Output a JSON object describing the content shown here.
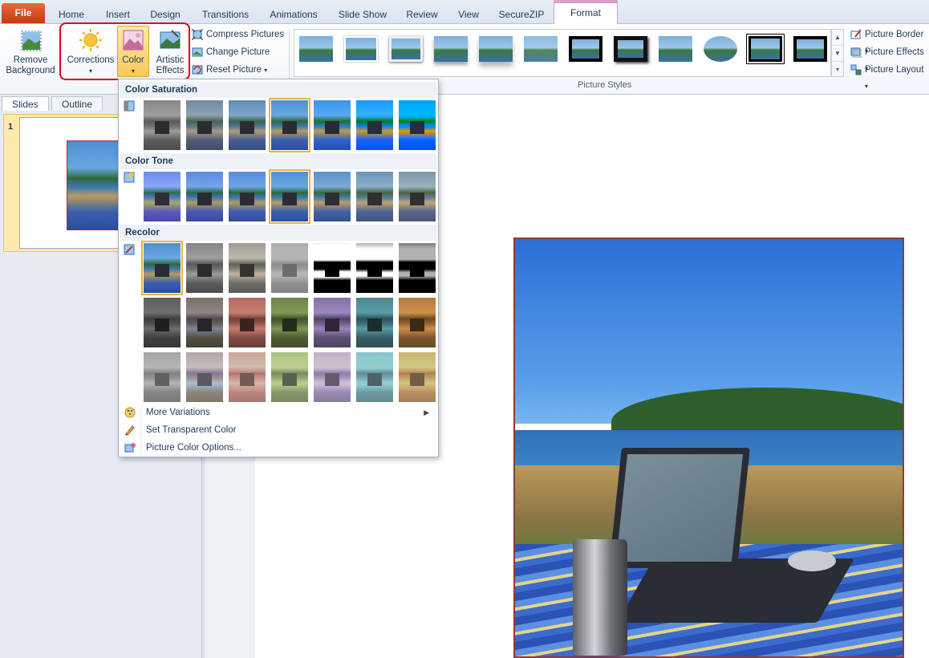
{
  "tabs": [
    "File",
    "Home",
    "Insert",
    "Design",
    "Transitions",
    "Animations",
    "Slide Show",
    "Review",
    "View",
    "SecureZIP",
    "Format"
  ],
  "active_tab": "Format",
  "ribbon": {
    "remove_background": "Remove Background",
    "corrections": "Corrections",
    "color": "Color",
    "artistic_effects": "Artistic Effects",
    "compress_pictures": "Compress Pictures",
    "change_picture": "Change Picture",
    "reset_picture": "Reset Picture",
    "picture_styles_label": "Picture Styles",
    "picture_border": "Picture Border",
    "picture_effects": "Picture Effects",
    "picture_layout": "Picture Layout"
  },
  "panel": {
    "slides_tab": "Slides",
    "outline_tab": "Outline",
    "slide_number": "1"
  },
  "color_menu": {
    "sections": [
      {
        "title": "Color Saturation",
        "selected_index": 3
      },
      {
        "title": "Color Tone",
        "selected_index": 3
      },
      {
        "title": "Recolor",
        "selected_index": 0
      }
    ],
    "items": [
      {
        "label": "More Variations",
        "has_submenu": true
      },
      {
        "label": "Set Transparent Color",
        "has_submenu": false
      },
      {
        "label": "Picture Color Options...",
        "has_submenu": false
      }
    ]
  },
  "colors": {
    "accent": "#e0001a",
    "selected": "#f8c95d",
    "file_tab": "#c23b13"
  }
}
